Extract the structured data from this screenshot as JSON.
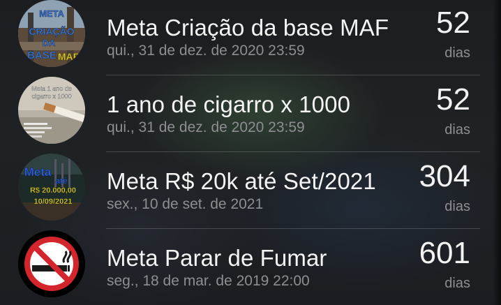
{
  "goals": [
    {
      "title": "Meta Criação da base MAF",
      "date": "qui., 31 de dez. de 2020 23:59",
      "count": "52",
      "unit": "dias",
      "icon": "construction-photo-icon",
      "icon_text": [
        "META",
        "CRIAÇÃO",
        "DA",
        "BASE",
        "MAF"
      ]
    },
    {
      "title": "1 ano de cigarro x 1000",
      "date": "qui., 31 de dez. de 2020 23:59",
      "count": "52",
      "unit": "dias",
      "icon": "cigarette-photo-icon",
      "icon_text": [
        "Meta 1 ano de",
        "cigarro x 1000"
      ]
    },
    {
      "title": "Meta R$ 20k até Set/2021",
      "date": "sex., 10 de set. de 2021",
      "count": "304",
      "unit": "dias",
      "icon": "money-goal-icon",
      "icon_text": [
        "Meta",
        "R$ 20.000,00",
        "até",
        "10/09/2021"
      ]
    },
    {
      "title": "Meta Parar de Fumar",
      "date": "seg., 18 de mar. de 2019 22:00",
      "count": "601",
      "unit": "dias",
      "icon": "no-smoking-icon",
      "icon_text": []
    }
  ],
  "colors": {
    "title": "#f4f4f4",
    "secondary": "#8e8e92",
    "no_smoking_red": "#d4252c"
  }
}
